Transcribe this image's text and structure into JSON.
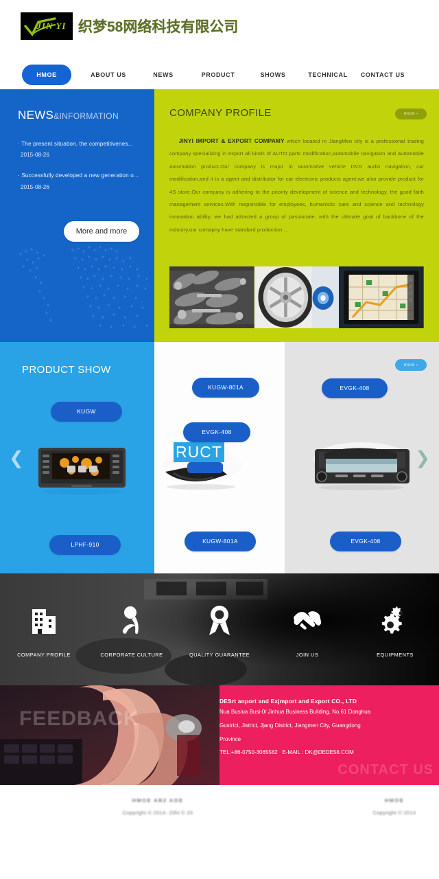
{
  "header": {
    "logo_en": "JIN YI",
    "logo_cn": "织梦58网络科技有限公司"
  },
  "nav": {
    "items": [
      {
        "label": "HMOE",
        "active": true
      },
      {
        "label": "ABOUT US",
        "active": false
      },
      {
        "label": "NEWS",
        "active": false
      },
      {
        "label": "PRODUCT",
        "active": false
      },
      {
        "label": "SHOWS",
        "active": false
      },
      {
        "label": "TECHNICAL",
        "active": false
      },
      {
        "label": "CONTACT US",
        "active": false
      }
    ]
  },
  "news": {
    "title_main": "NEWS",
    "title_sub": "&INFORMATION",
    "items": [
      {
        "title": "The present situation, the competitivenes...",
        "date": "2015-08-26"
      },
      {
        "title": "Successfully developed a new generation o...",
        "date": "2015-08-26"
      }
    ],
    "more_label": "More and more"
  },
  "profile": {
    "title": "COMPANY PROFILE",
    "more_label": "more",
    "lead": "JINYI IMPORT & EXPORT COMPAMY",
    "body": " which located in JiangMen city is a professional trading company specializing in export all kinds of AUTO parts modification,automobile navigation and automobile automation product.Our company is major in automotive vehicle DVD audio navigation, car modification,and it is a agent and distributor for car electronic products agent,we also provide product for 4S store.Our company is adhering to the priority development of science and technology, the good faith management services.With responsible for employees, humanistic care and science and technology innovation ability, we had attracted a group of passionate, with the ultimate goal of backbone of the industry,our comapny have standard production ..."
  },
  "product_show": {
    "title": "PRODUCT SHOW",
    "more_label": "more",
    "ghost_word": "RUCT",
    "prev_icon": "chevron-left-icon",
    "next_icon": "chevron-right-icon",
    "columns": [
      {
        "top_label": "KUGW",
        "bottom_label": "LPHF-910"
      },
      {
        "top_label": "KUGW-801A",
        "mid_label": "EVGK-408",
        "bottom_label": "KUGW-801A"
      },
      {
        "top_label": "EVGK-408",
        "bottom_label": "EVGK-408"
      }
    ]
  },
  "features": {
    "items": [
      {
        "label": "COMPANY PROFILE",
        "icon": "building-icon"
      },
      {
        "label": "CORPORATE CULTURE",
        "icon": "person-icon"
      },
      {
        "label": "QUALITY GUARANTEE",
        "icon": "award-ribbon-icon"
      },
      {
        "label": "JOIN US",
        "icon": "handshake-icon"
      },
      {
        "label": "EQUIPMENTS",
        "icon": "gears-icon"
      }
    ]
  },
  "feedback": {
    "word": "FEEDBACK",
    "ghost_word": "CONTACT US",
    "company": "DESrt anport and Exjmport and Export CO., LTD",
    "address_line1": "Nua Busiua Busi-0/ Jinhua Business Building, No.61 Donghua",
    "address_line2": "Gustrict, Jistrict, Jjang District, Jiangmen City, Guangdong",
    "address_line3": "Province",
    "tel_label": "TEL:",
    "tel": "+86-0750-3065582",
    "email_label": "E-MAIL :",
    "email": "DK@DEDE58.COM"
  },
  "footer": {
    "left": {
      "links": "HMOE   AB2   AOE",
      "copyright": "Copyright © 2014-  20ht © 20"
    },
    "right": {
      "links": "HMOE",
      "copyright": "Copyright © 2014"
    }
  },
  "colors": {
    "brand_blue": "#1464d6",
    "news_blue": "#1565c8",
    "profile_green": "#c1d40b",
    "product_blue": "#29a3e5",
    "pill_blue": "#1a5fc8",
    "feedback_pink": "#ed1f5e",
    "logo_green": "#a8d21a"
  }
}
